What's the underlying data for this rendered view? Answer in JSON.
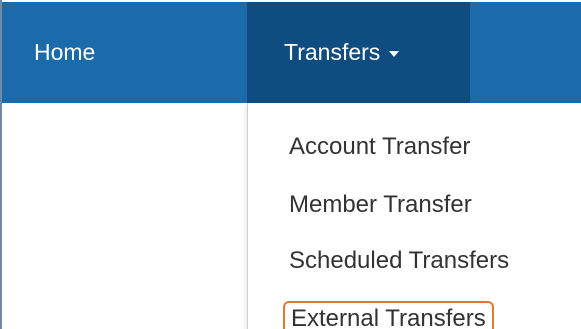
{
  "navbar": {
    "home_label": "Home",
    "transfers_label": "Transfers",
    "accent": "#1b6aa9",
    "active_background": "#0f4c7f"
  },
  "dropdown": {
    "items": [
      {
        "label": "Account Transfer"
      },
      {
        "label": "Member Transfer"
      },
      {
        "label": "Scheduled Transfers"
      },
      {
        "label": "External Transfers",
        "highlighted": true
      }
    ],
    "highlight_color": "#e07a2e"
  }
}
